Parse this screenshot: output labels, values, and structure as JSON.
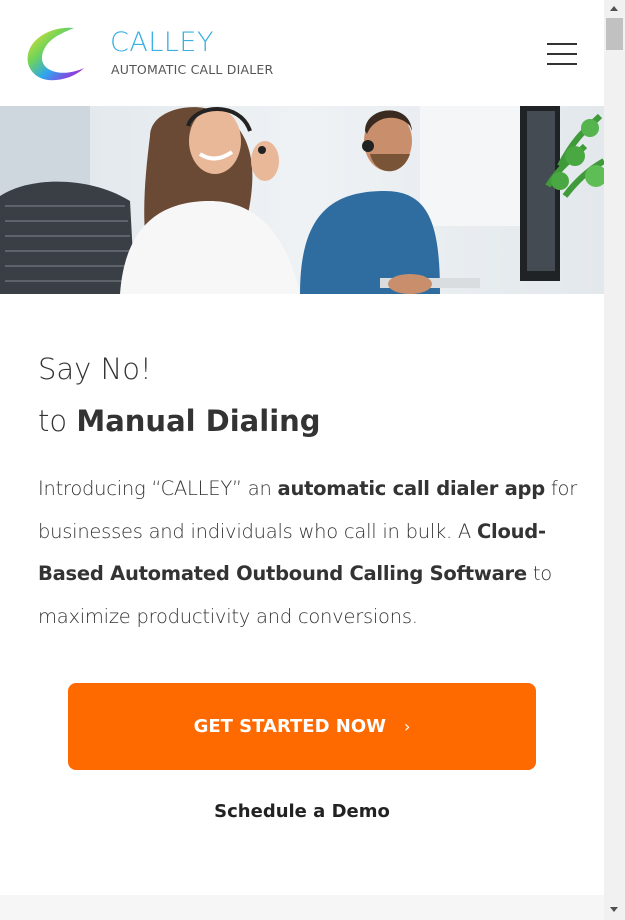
{
  "header": {
    "brand_name": "CALLEY",
    "brand_tagline": "AUTOMATIC CALL DIALER",
    "menu_icon": "hamburger-menu-icon"
  },
  "hero": {
    "image_label": "call-center-agents-photo"
  },
  "main": {
    "headline_line1": "Say No!",
    "headline_line2_prefix": "to ",
    "headline_line2_bold": "Manual Dialing",
    "intro_part1": "Introducing “CALLEY” an ",
    "intro_bold1": "automatic call dialer app",
    "intro_part2": " for businesses and individuals who call in bulk. A ",
    "intro_bold2": "Cloud-Based Automated Outbound Calling Software",
    "intro_part3": " to maximize productivity and conversions.",
    "cta_label": "GET STARTED NOW",
    "cta_icon": "chevron-right-icon",
    "demo_label": "Schedule a Demo"
  },
  "colors": {
    "brand_blue": "#3ab0e2",
    "cta_orange": "#ff6a00",
    "text_dark": "#333333"
  }
}
